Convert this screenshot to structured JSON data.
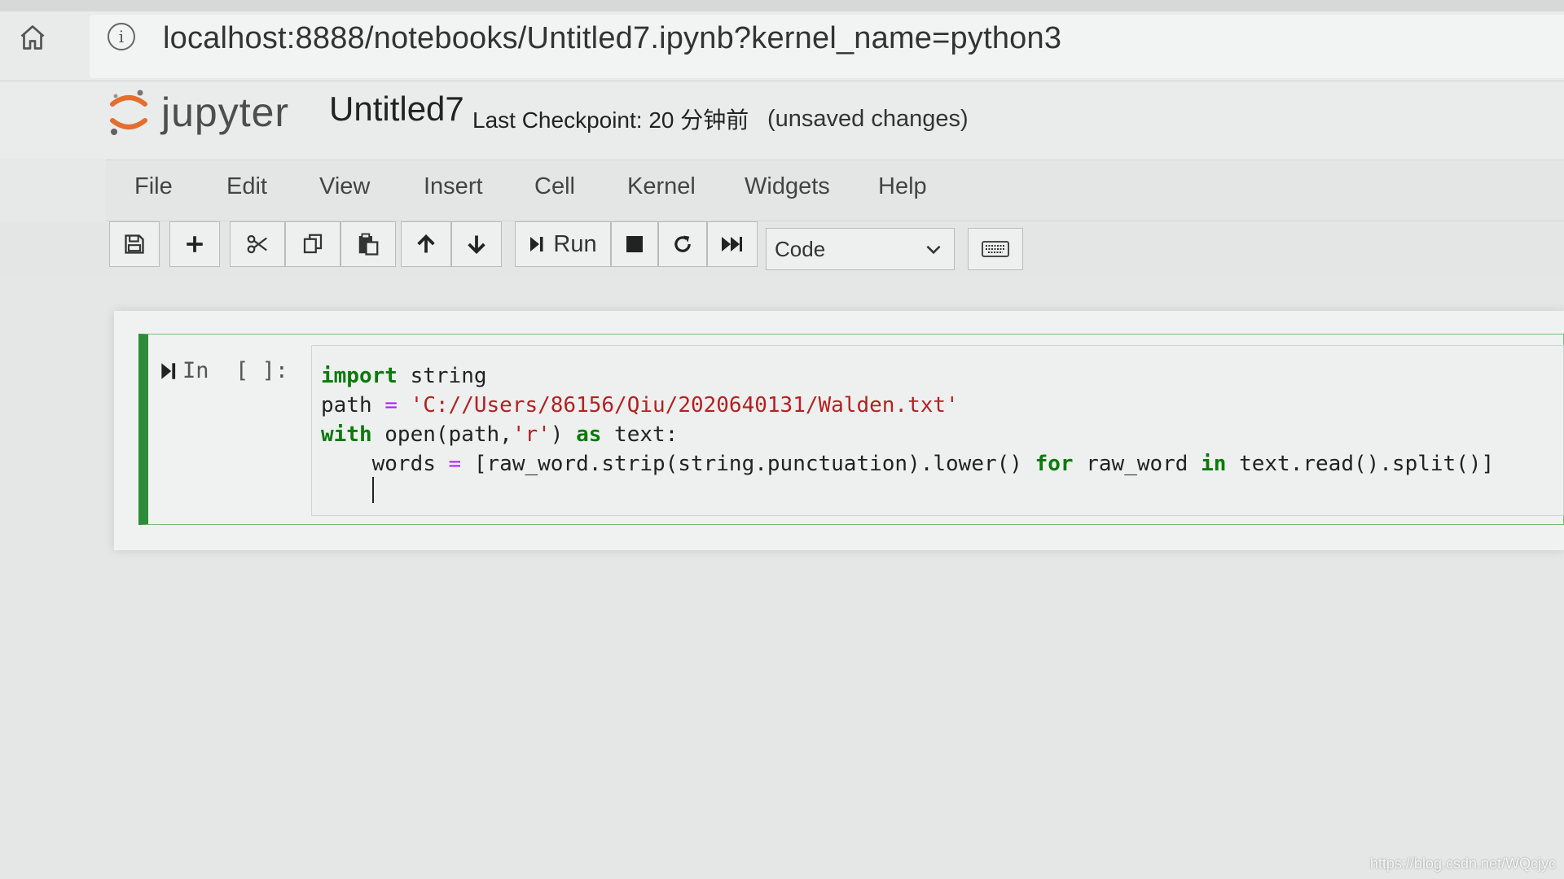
{
  "browser": {
    "url": "localhost:8888/notebooks/Untitled7.ipynb?kernel_name=python3"
  },
  "header": {
    "logo_text": "jupyter",
    "notebook_title": "Untitled7",
    "checkpoint": "Last Checkpoint: 20 分钟前",
    "unsaved": "(unsaved changes)"
  },
  "menu": {
    "items": [
      "File",
      "Edit",
      "View",
      "Insert",
      "Cell",
      "Kernel",
      "Widgets",
      "Help"
    ]
  },
  "toolbar": {
    "run_label": "Run",
    "cell_type": "Code",
    "icons": [
      "save-icon",
      "plus-icon",
      "scissors-icon",
      "copy-icon",
      "paste-icon",
      "arrow-up-icon",
      "arrow-down-icon",
      "run-icon",
      "stop-icon",
      "restart-icon",
      "fast-forward-icon",
      "chevron-down-icon",
      "keyboard-icon"
    ]
  },
  "cell": {
    "prompt": "In  [ ]:",
    "code": {
      "l1_kw": "import",
      "l1_rest": " string",
      "l2_a": "path ",
      "l2_eq": "=",
      "l2_sp": " ",
      "l2_str": "'C://Users/86156/Qiu/2020640131/Walden.txt'",
      "l3_kw": "with",
      "l3_a": " open(path,",
      "l3_str": "'r'",
      "l3_b": ") ",
      "l3_kw2": "as",
      "l3_c": " text:",
      "l4_a": "    words ",
      "l4_eq": "=",
      "l4_b": " [raw_word.strip(string.punctuation).lower() ",
      "l4_kw": "for",
      "l4_c": " raw_word ",
      "l4_kw2": "in",
      "l4_d": " text.read().split()]"
    }
  },
  "watermark": "https://blog.csdn.net/WQcjyc",
  "colors": {
    "cell_border_active": "#2e8b3a",
    "keyword": "#0a7a0a",
    "string": "#b22222",
    "logo_orange": "#e46e2e"
  }
}
